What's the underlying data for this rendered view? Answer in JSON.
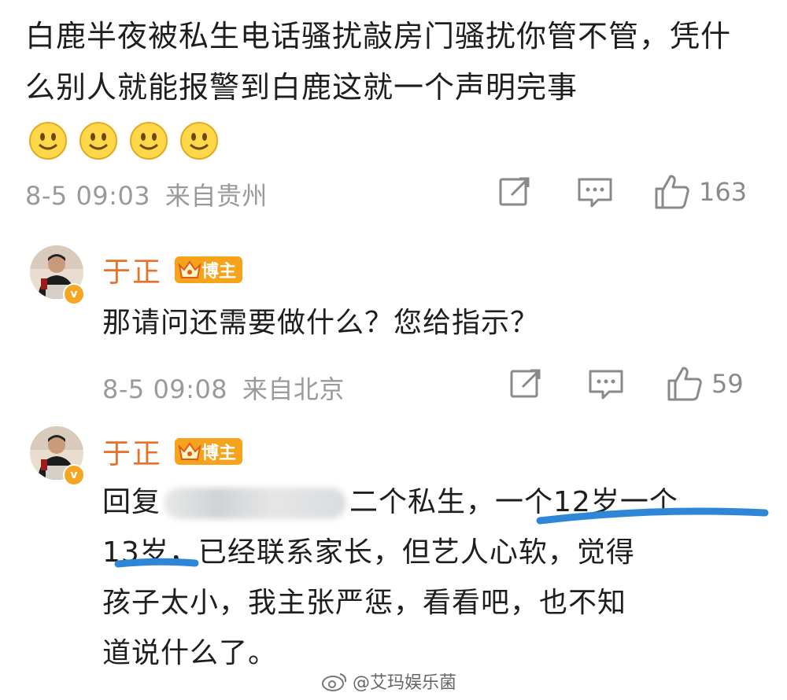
{
  "top_comment": {
    "text": "白鹿半夜被私生电话骚扰敲房门骚扰你管不管，凭什么别人就能报警到白鹿这就一个声明完事",
    "emoji_names": [
      "smile-emoji",
      "smile-emoji",
      "smile-emoji",
      "smile-emoji"
    ],
    "time": "8-5 09:03",
    "source": "来自贵州",
    "likes": "163"
  },
  "reply1": {
    "user": "于正",
    "badge": "博主",
    "text": "那请问还需要做什么？您给指示？",
    "time": "8-5 09:08",
    "source": "来自北京",
    "likes": "59"
  },
  "reply2": {
    "user": "于正",
    "badge": "博主",
    "prefix": "回复",
    "after_blur": "二个私生，",
    "highlight1": "一个12岁一个",
    "highlight2": "13岁",
    "line2_rest": "，已经联系家长，但艺人心软，觉得",
    "line3": "孩子太小，我主张严惩，看看吧，也不知",
    "line4": "道说什么了。"
  },
  "watermark": "@艾玛娱乐菌",
  "colors": {
    "username": "#e8702a",
    "badge": "#f7a21b",
    "underline": "#2d86d6",
    "meta": "#9a9a9a"
  }
}
